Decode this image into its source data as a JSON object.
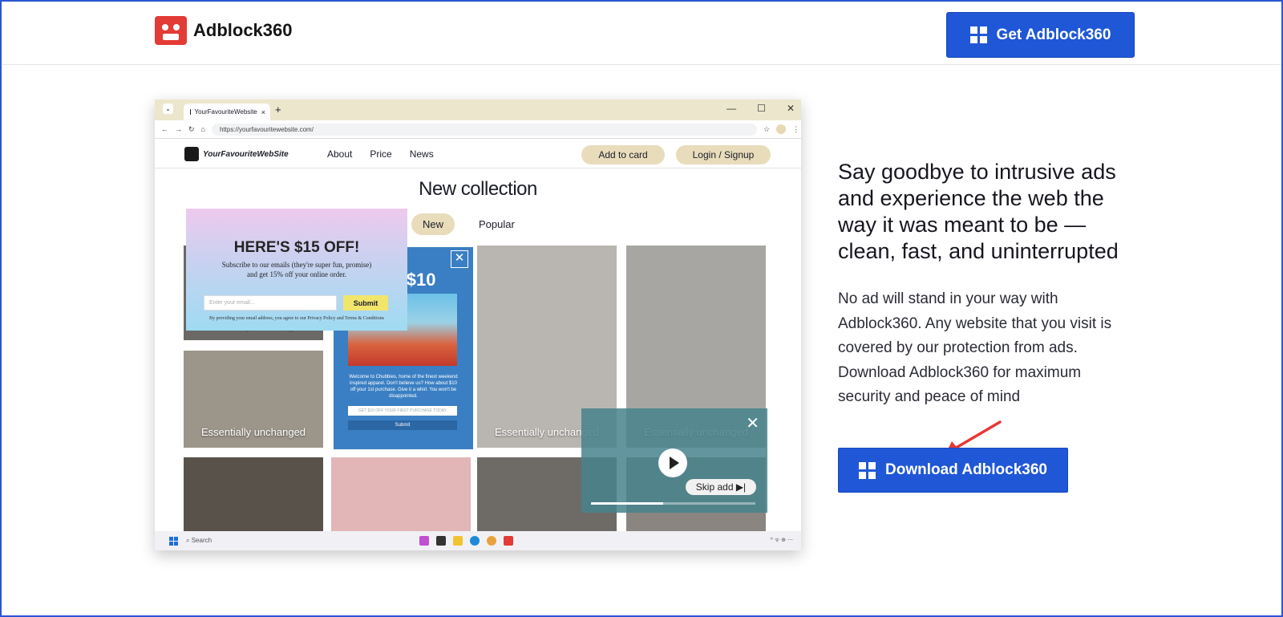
{
  "header": {
    "brand": "Adblock360",
    "cta_label": "Get Adblock360"
  },
  "mock_browser": {
    "tab_title": "YourFavouriteWebsite",
    "tab_close": "×",
    "new_tab": "+",
    "window_controls": [
      "—",
      "☐",
      "✕"
    ],
    "url": "https://yourfavouritewebsite.com/",
    "site": {
      "logo_text": "YourFavouriteWebSite",
      "nav": [
        "About",
        "Price",
        "News"
      ],
      "add_to_card": "Add to card",
      "login": "Login / Signup",
      "collection_title": "New collection",
      "filters": [
        "New",
        "Popular"
      ],
      "tile_caption": "Essentially unchanged"
    },
    "popup_discount": {
      "title": "HERE'S $15 OFF!",
      "text_1": "Subscribe to our emails (they're super fun, promise)",
      "text_2": "and get 15% off your online order.",
      "email_placeholder": "Enter your email...",
      "submit": "Submit",
      "note": "By providing your email address, you agree to our Privacy Policy and Terms & Conditions"
    },
    "popup_ad": {
      "headline": "S $10",
      "body": "Welcome to Chubbies, home of the finest weekend inspired apparel. Don't believe us? How about $10 off your 1st purchase. Give it a whirl. You won't be disappointed.",
      "field": "GET $10 OFF YOUR FIRST PURCHASE TODAY",
      "submit": "Submit"
    },
    "video_ad": {
      "skip": "Skip add ▶|",
      "progress": 0.44
    },
    "taskbar": {
      "search": "Search",
      "tray": "^ ᯤ ⊕ ⋯"
    }
  },
  "content": {
    "headline": "Say goodbye to intrusive ads and experience the web the way it was meant to be — clean, fast, and uninterrupted",
    "body": "No ad will stand in your way with Adblock360. Any website that you visit is covered by our protection from ads. Download Adblock360 for maximum security and peace of mind",
    "download_label": "Download Adblock360"
  },
  "colors": {
    "brand_blue": "#1f57d6",
    "logo_red": "#e33b35",
    "arrow_red": "#e53935"
  }
}
